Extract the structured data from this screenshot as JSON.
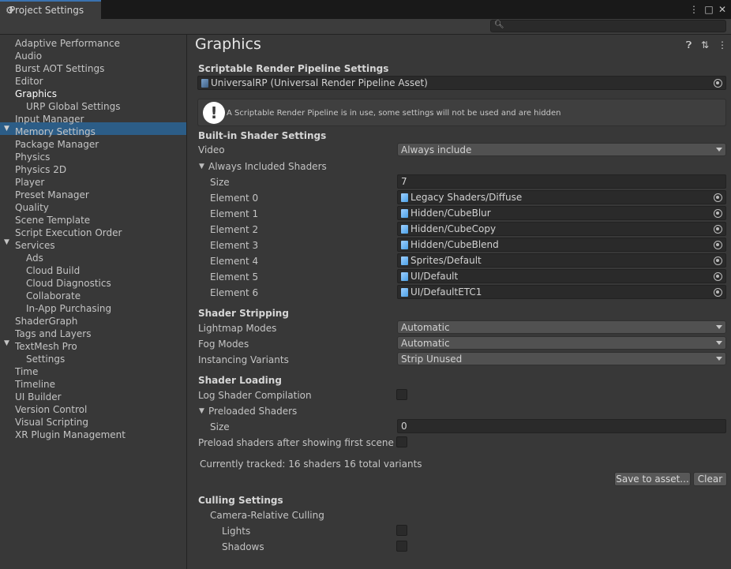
{
  "window": {
    "tab_title": "Project Settings",
    "controls": {
      "menu": "⋮",
      "maximize": "□",
      "close": "✕"
    }
  },
  "search": {
    "placeholder": "",
    "icon": "search-icon"
  },
  "sidebar": {
    "items": [
      {
        "label": "Adaptive Performance"
      },
      {
        "label": "Audio"
      },
      {
        "label": "Burst AOT Settings"
      },
      {
        "label": "Editor"
      },
      {
        "label": "Graphics",
        "selected": true
      },
      {
        "label": "URP Global Settings"
      },
      {
        "label": "Input Manager"
      },
      {
        "label": "Memory Settings"
      },
      {
        "label": "Package Manager"
      },
      {
        "label": "Physics"
      },
      {
        "label": "Physics 2D"
      },
      {
        "label": "Player"
      },
      {
        "label": "Preset Manager"
      },
      {
        "label": "Quality"
      },
      {
        "label": "Scene Template"
      },
      {
        "label": "Script Execution Order"
      },
      {
        "label": "Services"
      },
      {
        "label": "Ads"
      },
      {
        "label": "Cloud Build"
      },
      {
        "label": "Cloud Diagnostics"
      },
      {
        "label": "Collaborate"
      },
      {
        "label": "In-App Purchasing"
      },
      {
        "label": "ShaderGraph"
      },
      {
        "label": "Tags and Layers"
      },
      {
        "label": "TextMesh Pro"
      },
      {
        "label": "Settings"
      },
      {
        "label": "Time"
      },
      {
        "label": "Timeline"
      },
      {
        "label": "UI Builder"
      },
      {
        "label": "Version Control"
      },
      {
        "label": "Visual Scripting"
      },
      {
        "label": "XR Plugin Management"
      }
    ]
  },
  "main": {
    "title": "Graphics",
    "srp": {
      "heading": "Scriptable Render Pipeline Settings",
      "asset": "UniversalRP (Universal Render Pipeline Asset)",
      "warning": "A Scriptable Render Pipeline is in use, some settings will not be used and are hidden"
    },
    "builtin": {
      "heading": "Built-in Shader Settings",
      "video_label": "Video",
      "video_value": "Always include",
      "always_included_label": "Always Included Shaders",
      "size_label": "Size",
      "size_value": "7",
      "elements": [
        {
          "label": "Element 0",
          "value": "Legacy Shaders/Diffuse"
        },
        {
          "label": "Element 1",
          "value": "Hidden/CubeBlur"
        },
        {
          "label": "Element 2",
          "value": "Hidden/CubeCopy"
        },
        {
          "label": "Element 3",
          "value": "Hidden/CubeBlend"
        },
        {
          "label": "Element 4",
          "value": "Sprites/Default"
        },
        {
          "label": "Element 5",
          "value": "UI/Default"
        },
        {
          "label": "Element 6",
          "value": "UI/DefaultETC1"
        }
      ]
    },
    "stripping": {
      "heading": "Shader Stripping",
      "lightmap_label": "Lightmap Modes",
      "lightmap_value": "Automatic",
      "fog_label": "Fog Modes",
      "fog_value": "Automatic",
      "instancing_label": "Instancing Variants",
      "instancing_value": "Strip Unused"
    },
    "loading": {
      "heading": "Shader Loading",
      "log_label": "Log Shader Compilation",
      "preloaded_label": "Preloaded Shaders",
      "size_label": "Size",
      "size_value": "0",
      "preload_after_label": "Preload shaders after showing first scene",
      "tracked_text": "Currently tracked: 16 shaders 16 total variants",
      "save_button": "Save to asset...",
      "clear_button": "Clear"
    },
    "culling": {
      "heading": "Culling Settings",
      "camera_relative_label": "Camera-Relative Culling",
      "lights_label": "Lights",
      "shadows_label": "Shadows"
    }
  },
  "colors": {
    "selection": "#2c5d87",
    "accent": "#3a72b0"
  }
}
